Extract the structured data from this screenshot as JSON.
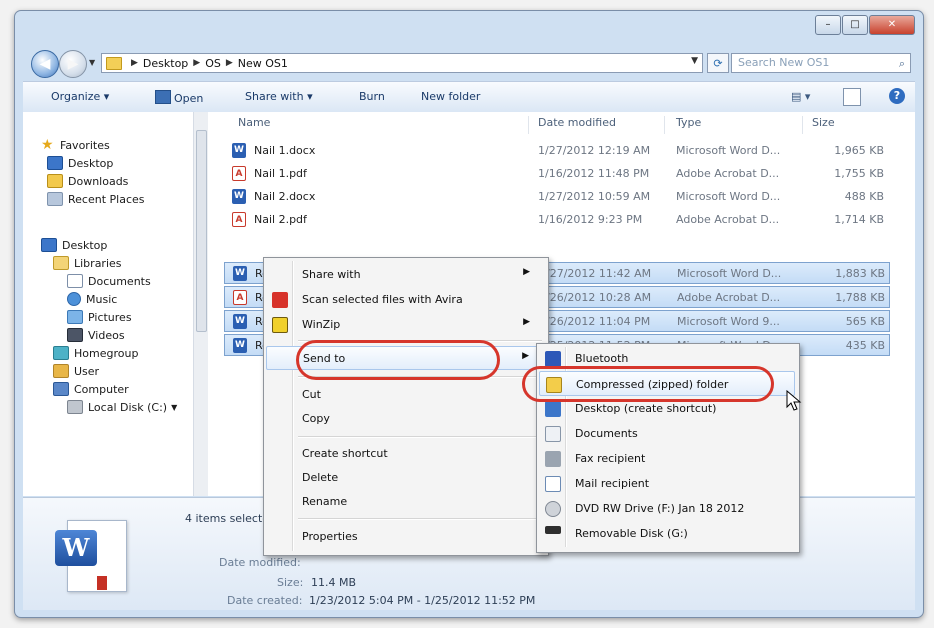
{
  "window": {
    "caption_min": "–",
    "caption_max": "□",
    "caption_close": "✕"
  },
  "nav": {
    "breadcrumb": [
      "Desktop",
      "OS",
      "New OS1"
    ],
    "search_placeholder": "Search New OS1"
  },
  "toolbar": {
    "organize": "Organize ▾",
    "open": "Open",
    "share_with": "Share with ▾",
    "burn": "Burn",
    "new_folder": "New folder"
  },
  "sidebar": {
    "items": [
      {
        "label": "Favorites",
        "icon": "star-icon"
      },
      {
        "label": "Desktop",
        "icon": "desktop-icon"
      },
      {
        "label": "Downloads",
        "icon": "folder-icon"
      },
      {
        "label": "Recent Places",
        "icon": "recent-places-icon"
      },
      {
        "label": "Desktop",
        "icon": "desktop-icon"
      },
      {
        "label": "Libraries",
        "icon": "libraries-icon"
      },
      {
        "label": "Documents",
        "icon": "documents-icon"
      },
      {
        "label": "Music",
        "icon": "music-icon"
      },
      {
        "label": "Pictures",
        "icon": "pictures-icon"
      },
      {
        "label": "Videos",
        "icon": "videos-icon"
      },
      {
        "label": "Homegroup",
        "icon": "homegroup-icon"
      },
      {
        "label": "User",
        "icon": "user-icon"
      },
      {
        "label": "Computer",
        "icon": "computer-icon"
      },
      {
        "label": "Local Disk (C:)",
        "icon": "disk-icon"
      }
    ]
  },
  "columns": {
    "name": "Name",
    "date": "Date modified",
    "type": "Type",
    "size": "Size"
  },
  "files": [
    {
      "name": "Nail 1.docx",
      "date": "1/27/2012 12:19 AM",
      "type": "Microsoft Word D...",
      "size": "1,965 KB",
      "kind": "word"
    },
    {
      "name": "Nail 1.pdf",
      "date": "1/16/2012 11:48 PM",
      "type": "Adobe Acrobat D...",
      "size": "1,755 KB",
      "kind": "pdf"
    },
    {
      "name": "Nail 2.docx",
      "date": "1/27/2012 10:59 AM",
      "type": "Microsoft Word D...",
      "size": "488 KB",
      "kind": "word"
    },
    {
      "name": "Nail 2.pdf",
      "date": "1/16/2012 9:23 PM",
      "type": "Adobe Acrobat D...",
      "size": "1,714 KB",
      "kind": "pdf"
    },
    {
      "name": "Re",
      "date": "1/27/2012 11:42 AM",
      "type": "Microsoft Word D...",
      "size": "1,883 KB",
      "kind": "word"
    },
    {
      "name": "Re",
      "date": "1/26/2012 10:28 AM",
      "type": "Adobe Acrobat D...",
      "size": "1,788 KB",
      "kind": "pdf"
    },
    {
      "name": "Re",
      "date": "1/26/2012 11:04 PM",
      "type": "Microsoft Word 9...",
      "size": "565 KB",
      "kind": "word"
    },
    {
      "name": "Re",
      "date": "1/25/2012 11:52 PM",
      "type": "Microsoft Word D...",
      "size": "435 KB",
      "kind": "word"
    }
  ],
  "details": {
    "selected": "4 items selected",
    "date_label": "Date modified:",
    "size_label": "Size:",
    "size_value": "11.4 MB",
    "created_label": "Date created:",
    "created_value": "1/23/2012 5:04 PM - 1/25/2012 11:52 PM"
  },
  "context_menu": {
    "share_with": "Share with",
    "scan": "Scan selected files with Avira",
    "winzip": "WinZip",
    "send_to": "Send to",
    "cut": "Cut",
    "copy": "Copy",
    "create_shortcut": "Create shortcut",
    "delete": "Delete",
    "rename": "Rename",
    "properties": "Properties",
    "arrow": "▶"
  },
  "send_to_menu": [
    {
      "label": "Bluetooth",
      "icon": "bluetooth-icon"
    },
    {
      "label": "Compressed (zipped) folder",
      "icon": "zip-folder-icon"
    },
    {
      "label": "Desktop (create shortcut)",
      "icon": "desktop-icon"
    },
    {
      "label": "Documents",
      "icon": "documents-icon"
    },
    {
      "label": "Fax recipient",
      "icon": "fax-icon"
    },
    {
      "label": "Mail recipient",
      "icon": "mail-icon"
    },
    {
      "label": "DVD RW Drive (F:) Jan 18 2012",
      "icon": "dvd-icon"
    },
    {
      "label": "Removable Disk (G:)",
      "icon": "usb-icon"
    }
  ],
  "colors": {
    "highlight_ring": "#d6362c",
    "selection": "#c4dcf6"
  }
}
